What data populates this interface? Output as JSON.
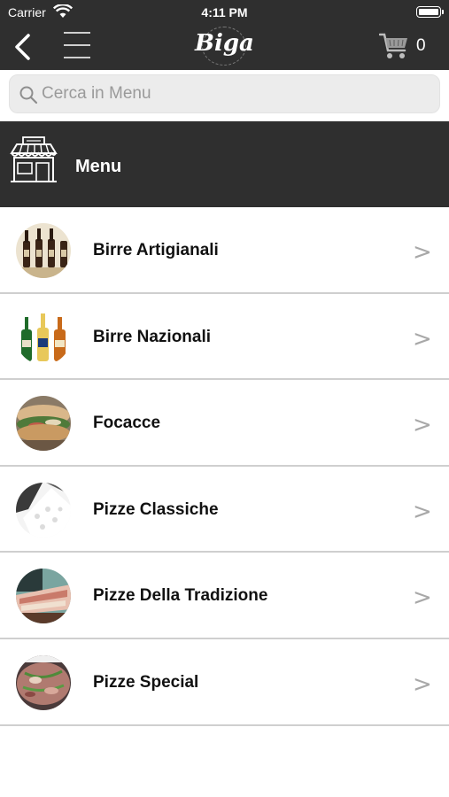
{
  "status_bar": {
    "carrier": "Carrier",
    "time": "4:11 PM"
  },
  "nav": {
    "logo_text": "Biga",
    "cart_count": "0"
  },
  "search": {
    "placeholder": "Cerca in Menu",
    "value": ""
  },
  "header": {
    "title": "Menu"
  },
  "categories": [
    {
      "label": "Birre Artigianali",
      "chevron": ">"
    },
    {
      "label": "Birre Nazionali",
      "chevron": ">"
    },
    {
      "label": "Focacce",
      "chevron": ">"
    },
    {
      "label": "Pizze Classiche",
      "chevron": ">"
    },
    {
      "label": "Pizze Della Tradizione",
      "chevron": ">"
    },
    {
      "label": "Pizze Special",
      "chevron": ">"
    }
  ],
  "colors": {
    "bar_background": "#2f2f2f",
    "row_divider": "#cfcfcf",
    "chevron": "#a8a8a8"
  }
}
